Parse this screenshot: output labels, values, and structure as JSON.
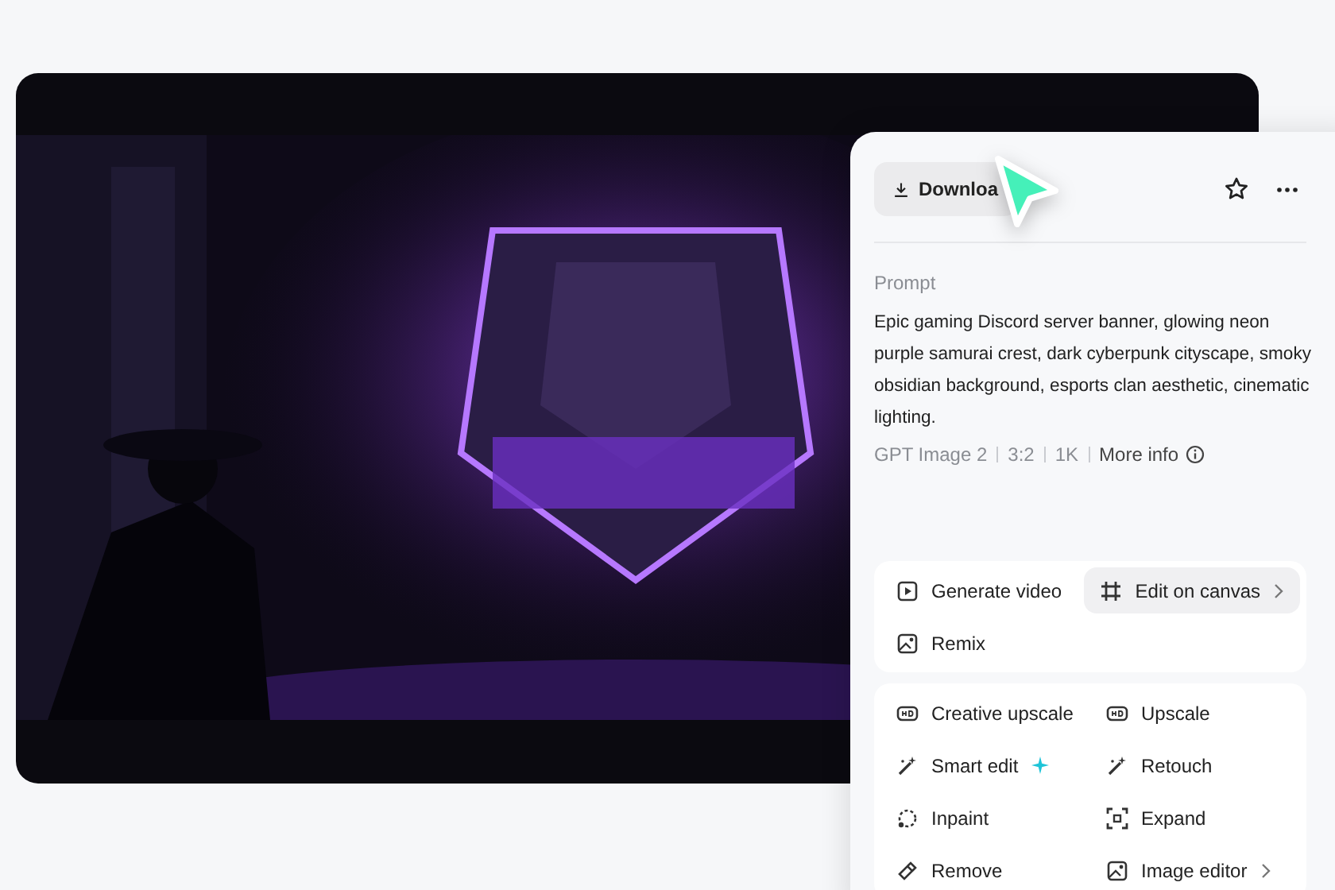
{
  "panel": {
    "download_button": "Downloa",
    "prompt_label": "Prompt",
    "prompt": "Epic gaming Discord server banner, glowing neon purple samurai crest, dark cyberpunk cityscape, smoky obsidian background, esports clan aesthetic, cinematic lighting.",
    "meta": [
      "GPT Image 2",
      "3:2",
      "1K"
    ],
    "more_info": "More info",
    "primary_actions": [
      {
        "label": "Generate video",
        "submenu": false,
        "hovered": false,
        "sparkle": false
      },
      {
        "label": "Edit on canvas",
        "submenu": true,
        "hovered": true,
        "sparkle": false
      },
      {
        "label": "Remix",
        "submenu": false,
        "hovered": false,
        "sparkle": false
      }
    ],
    "edit_actions": [
      {
        "label": "Creative upscale",
        "submenu": false,
        "hovered": false,
        "sparkle": false
      },
      {
        "label": "Upscale",
        "submenu": false,
        "hovered": false,
        "sparkle": false
      },
      {
        "label": "Smart edit",
        "submenu": false,
        "hovered": false,
        "sparkle": true
      },
      {
        "label": "Retouch",
        "submenu": false,
        "hovered": false,
        "sparkle": false
      },
      {
        "label": "Inpaint",
        "submenu": false,
        "hovered": false,
        "sparkle": false
      },
      {
        "label": "Expand",
        "submenu": false,
        "hovered": false,
        "sparkle": false
      },
      {
        "label": "Remove",
        "submenu": false,
        "hovered": false,
        "sparkle": false
      },
      {
        "label": "Image editor",
        "submenu": true,
        "hovered": false,
        "sparkle": false
      }
    ]
  }
}
